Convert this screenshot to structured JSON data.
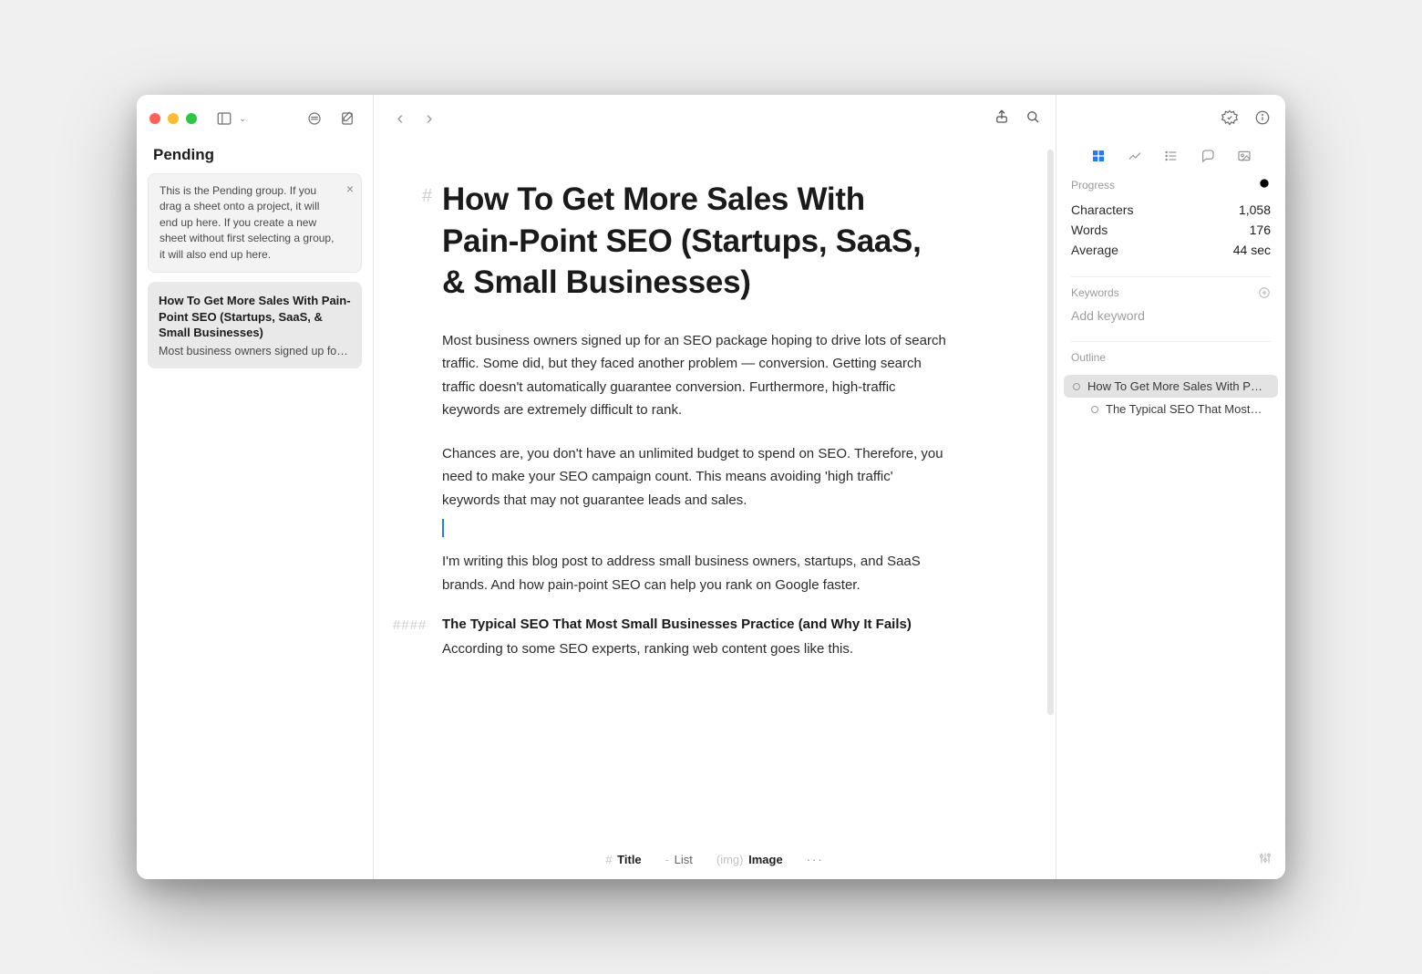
{
  "sidebar": {
    "group_title": "Pending",
    "info_text": "This is the Pending group. If you drag a sheet onto a project, it will end up here. If you create a new sheet without first selecting a group, it will also end up here.",
    "notes": [
      {
        "title": "How To Get More Sales With Pain-Point SEO (Startups, SaaS, & Small Businesses)",
        "preview": "Most business owners signed up for…"
      }
    ]
  },
  "document": {
    "h1": "How To Get More Sales With Pain-Point SEO (Startups, SaaS, & Small Businesses)",
    "para1": "Most business owners signed up for an SEO package hoping to drive lots of search traffic. Some did, but they faced another problem — conversion. Getting search traffic doesn't automatically guarantee conversion. Furthermore, high-traffic keywords are extremely difficult to rank.",
    "para2": "Chances are, you don't have an unlimited budget to spend on SEO. Therefore, you need to make your SEO campaign count. This means avoiding 'high traffic' keywords that may not guarantee leads and sales.",
    "para3": "I'm writing this blog post to address small business owners, startups, and SaaS brands. And how pain-point SEO can help you rank on Google faster.",
    "h4": "The Typical SEO That Most Small Businesses Practice (and Why It Fails)",
    "para4": "According to some SEO experts, ranking web content goes like this."
  },
  "formatbar": {
    "title": {
      "prefix": "#",
      "label": "Title"
    },
    "list": {
      "prefix": "-",
      "label": "List"
    },
    "image": {
      "prefix": "(img)",
      "label": "Image"
    }
  },
  "inspector": {
    "progress_label": "Progress",
    "stats": {
      "characters_label": "Characters",
      "characters_value": "1,058",
      "words_label": "Words",
      "words_value": "176",
      "average_label": "Average",
      "average_value": "44 sec"
    },
    "keywords_label": "Keywords",
    "keywords_placeholder": "Add keyword",
    "outline_label": "Outline",
    "outline": [
      {
        "text": "How To Get More Sales With Pain…",
        "level": 1,
        "selected": true
      },
      {
        "text": "The Typical SEO That Most…",
        "level": 2,
        "selected": false
      }
    ]
  }
}
